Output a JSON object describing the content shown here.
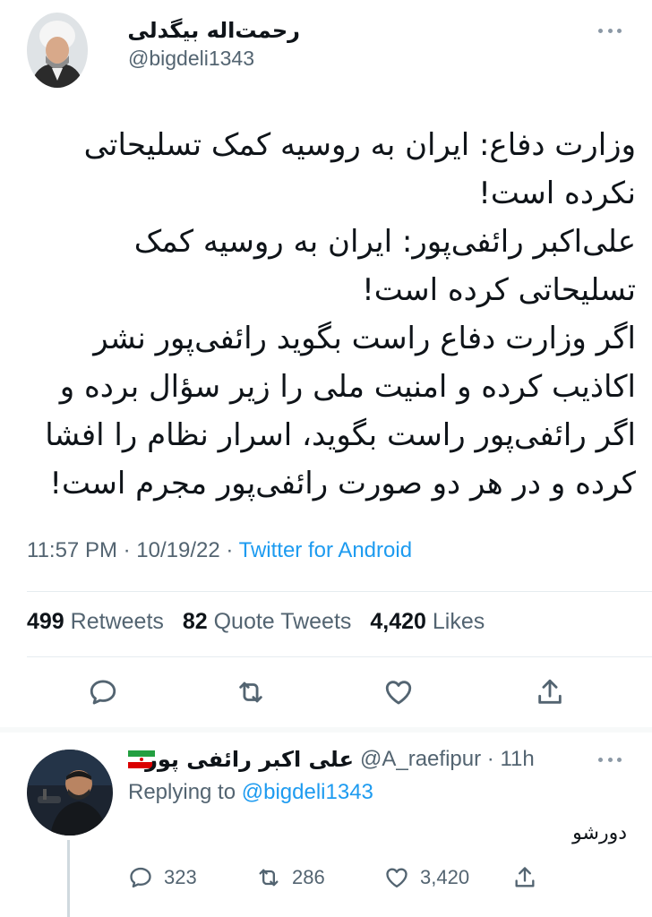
{
  "tweet": {
    "author_name": "رحمت‌اله بیگدلی",
    "author_handle": "@bigdeli1343",
    "more_icon": "more-horizontal-icon",
    "lines": [
      "وزارت دفاع: ایران به روسیه کمک تسلیحاتی",
      "نکرده است!",
      "علی‌اکبر رائفی‌پور:  ایران به روسیه کمک",
      "تسلیحاتی کرده است!",
      "اگر وزارت دفاع راست بگوید رائفی‌پور نشر",
      "اکاذیب کرده و امنیت ملی را زیر سؤال برده و",
      "اگر رائفی‌پور راست بگوید، اسرار نظام را افشا",
      "کرده و در هر دو صورت رائفی‌پور مجرم است!"
    ],
    "time": "11:57 PM",
    "date": "10/19/22",
    "separator": "·",
    "source": "Twitter for Android",
    "stats": {
      "retweets_count": "499",
      "retweets_label": "Retweets",
      "quotes_count": "82",
      "quotes_label": "Quote Tweets",
      "likes_count": "4,420",
      "likes_label": "Likes"
    }
  },
  "reply": {
    "author_name": "علی اکبر رائفی پور",
    "flag_icon": "iran-flag-icon",
    "author_handle": "@A_raefipur",
    "separator": "·",
    "age": "11h",
    "replying_prefix": "Replying to",
    "replying_mention": "@bigdeli1343",
    "text": "دورشو",
    "counts": {
      "replies": "323",
      "retweets": "286",
      "likes": "3,420"
    }
  },
  "colors": {
    "accent": "#1d9bf0",
    "secondary_text": "#536471",
    "primary_text": "#0f1419",
    "divider": "#e6ecf0"
  }
}
